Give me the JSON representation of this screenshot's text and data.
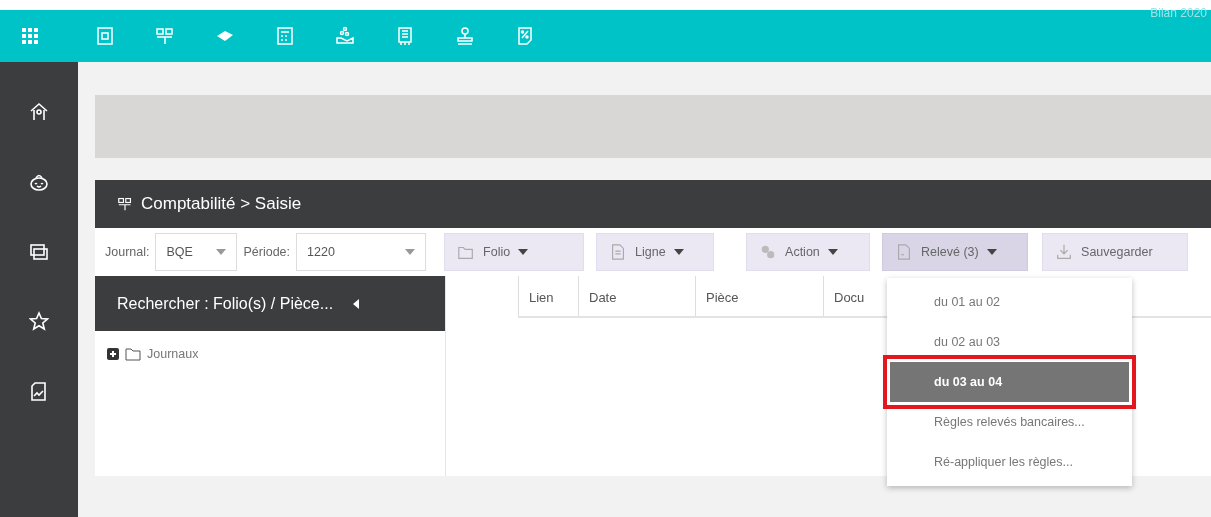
{
  "topbar": {
    "title": "Bilan 2020"
  },
  "breadcrumb": "Comptabilité > Saisie",
  "filters": [
    {
      "label": "Journal:",
      "value": "BQE"
    },
    {
      "label": "Période:",
      "value": "1220"
    }
  ],
  "toolbar_buttons": [
    {
      "label": "Folio",
      "dropdown": true,
      "expanded": false
    },
    {
      "label": "Ligne",
      "dropdown": true,
      "expanded": false
    },
    {
      "label": "Action",
      "dropdown": true,
      "expanded": false
    },
    {
      "label": "Relevé (3)",
      "dropdown": true,
      "expanded": true
    },
    {
      "label": "Sauvegarder",
      "dropdown": false,
      "expanded": false
    }
  ],
  "search_panel": {
    "title": "Rechercher : Folio(s) / Pièce...",
    "tree": [
      {
        "label": "Journaux",
        "expanded": false
      }
    ]
  },
  "table": {
    "columns": [
      "Lien",
      "Date",
      "Pièce",
      "Docu"
    ]
  },
  "menu": {
    "items": [
      {
        "label": "du 01 au 02",
        "selected": false,
        "annotated": false
      },
      {
        "label": "du 02 au 03",
        "selected": false,
        "annotated": false
      },
      {
        "label": "du 03 au 04",
        "selected": true,
        "annotated": true
      },
      {
        "label": "Règles relevés bancaires...",
        "selected": false,
        "annotated": false
      },
      {
        "label": "Ré-appliquer les règles...",
        "selected": false,
        "annotated": false
      }
    ]
  }
}
